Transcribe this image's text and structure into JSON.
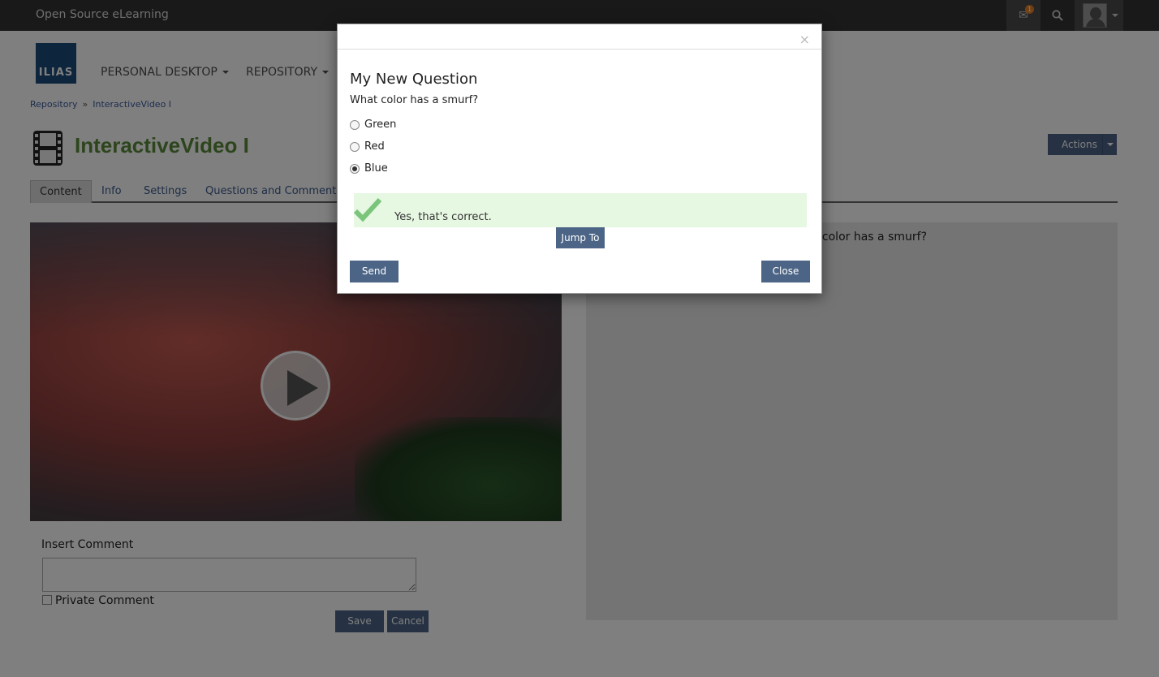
{
  "topbar": {
    "brand": "Open Source eLearning",
    "mail_badge": "1",
    "icons": [
      "mail-icon",
      "search-icon",
      "user-avatar"
    ]
  },
  "header": {
    "logo_text": "ILIAS",
    "nav": [
      {
        "label": "PERSONAL DESKTOP"
      },
      {
        "label": "REPOSITORY"
      }
    ]
  },
  "breadcrumb": {
    "items": [
      "Repository",
      "InteractiveVideo I"
    ],
    "separator": "»"
  },
  "page": {
    "title": "InteractiveVideo I",
    "actions_label": "Actions",
    "tabs": [
      "Content",
      "Info",
      "Settings",
      "Questions and Comments"
    ]
  },
  "side_panel": {
    "question_fragment": "t color has a smurf?"
  },
  "comment_form": {
    "label": "Insert Comment",
    "private_label": "Private Comment",
    "save_label": "Save",
    "cancel_label": "Cancel"
  },
  "modal": {
    "close_symbol": "×",
    "title": "My New Question",
    "question": "What color has a smurf?",
    "options": [
      {
        "label": "Green",
        "checked": false
      },
      {
        "label": "Red",
        "checked": false
      },
      {
        "label": "Blue",
        "checked": true
      }
    ],
    "feedback": "Yes, that's correct.",
    "jump_label": "Jump To",
    "send_label": "Send",
    "close_label": "Close"
  },
  "colors": {
    "topbar": "#333333",
    "primary_button": "#4c6586",
    "title_green": "#5a8a3a",
    "feedback_bg": "#e6f7e2",
    "check_green": "#7bc47b"
  }
}
